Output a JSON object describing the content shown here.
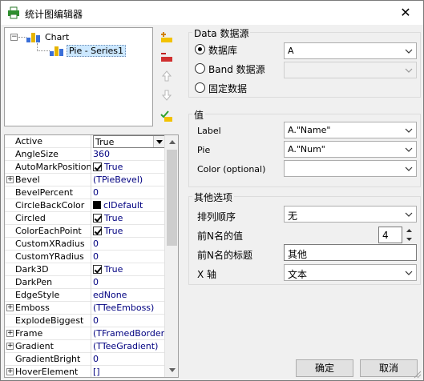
{
  "window": {
    "title": "统计图编辑器",
    "close_glyph": "✕",
    "icons": {
      "title": "printer-icon",
      "close": "close-icon"
    }
  },
  "tree": {
    "root": {
      "label": "Chart",
      "expander": "−"
    },
    "child": {
      "label": "Pie - Series1"
    }
  },
  "toolbar": {
    "items": [
      {
        "name": "add-series-icon",
        "color": "#f2c200"
      },
      {
        "name": "delete-series-icon",
        "color": "#d03030"
      },
      {
        "name": "move-up-icon",
        "color": "#b8b8b8"
      },
      {
        "name": "move-down-icon",
        "color": "#b8b8b8"
      },
      {
        "name": "check-edit-icon",
        "color": "#2ea02e"
      }
    ]
  },
  "properties": {
    "rows": [
      {
        "name": "Active",
        "value": "True",
        "kind": "combo"
      },
      {
        "name": "AngleSize",
        "value": "360"
      },
      {
        "name": "AutoMarkPosition",
        "value": "True",
        "kind": "check"
      },
      {
        "name": "Bevel",
        "value": "(TPieBevel)",
        "expandable": true
      },
      {
        "name": "BevelPercent",
        "value": "0"
      },
      {
        "name": "CircleBackColor",
        "value": "clDefault",
        "kind": "swatch"
      },
      {
        "name": "Circled",
        "value": "True",
        "kind": "check"
      },
      {
        "name": "ColorEachPoint",
        "value": "True",
        "kind": "check"
      },
      {
        "name": "CustomXRadius",
        "value": "0"
      },
      {
        "name": "CustomYRadius",
        "value": "0"
      },
      {
        "name": "Dark3D",
        "value": "True",
        "kind": "check"
      },
      {
        "name": "DarkPen",
        "value": "0"
      },
      {
        "name": "EdgeStyle",
        "value": "edNone"
      },
      {
        "name": "Emboss",
        "value": "(TTeeEmboss)",
        "expandable": true
      },
      {
        "name": "ExplodeBiggest",
        "value": "0"
      },
      {
        "name": "Frame",
        "value": "(TFramedBorder)",
        "expandable": true
      },
      {
        "name": "Gradient",
        "value": "(TTeeGradient)",
        "expandable": true
      },
      {
        "name": "GradientBright",
        "value": "0"
      },
      {
        "name": "HoverElement",
        "value": "[]",
        "expandable": true
      }
    ]
  },
  "datasource": {
    "title": "Data 数据源",
    "options": [
      {
        "label": "数据库",
        "selected": true,
        "combo": "A",
        "enabled": true
      },
      {
        "label": "Band 数据源",
        "selected": false,
        "combo": "",
        "enabled": false
      },
      {
        "label": "固定数据",
        "selected": false
      }
    ]
  },
  "values": {
    "title": "值",
    "fields": [
      {
        "label": "Label",
        "value": "A.\"Name\""
      },
      {
        "label": "Pie",
        "value": "A.\"Num\""
      },
      {
        "label": "Color (optional)",
        "value": ""
      }
    ]
  },
  "other": {
    "title": "其他选项",
    "sort": {
      "label": "排列顺序",
      "value": "无"
    },
    "topn": {
      "label": "前N名的值",
      "value": "4"
    },
    "topn_title": {
      "label": "前N名的标题",
      "value": "其他"
    },
    "xaxis": {
      "label": "X 轴",
      "value": "文本"
    }
  },
  "buttons": {
    "ok": "确定",
    "cancel": "取消"
  }
}
